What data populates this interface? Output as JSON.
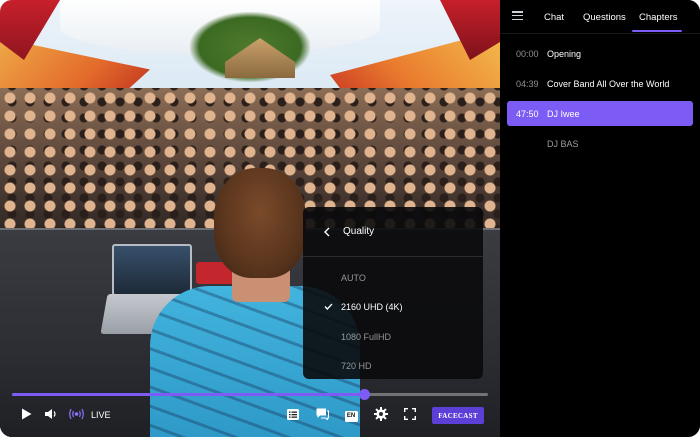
{
  "player": {
    "progress_fraction": 0.74,
    "live_label": "LIVE",
    "brand_label": "FACECAST",
    "accent_color": "#7c5cf5"
  },
  "quality_menu": {
    "title": "Quality",
    "options": [
      {
        "label": "AUTO",
        "selected": false
      },
      {
        "label": "2160 UHD (4K)",
        "selected": true
      },
      {
        "label": "1080 FullHD",
        "selected": false
      },
      {
        "label": "720 HD",
        "selected": false
      }
    ]
  },
  "panel": {
    "tabs": [
      "Chat",
      "Questions",
      "Chapters"
    ],
    "active_tab": "Chapters",
    "chapters": [
      {
        "time": "00:00",
        "title": "Opening",
        "active": false
      },
      {
        "time": "04:39",
        "title": "Cover Band All Over the World",
        "active": false
      },
      {
        "time": "47:50",
        "title": "DJ Iwee",
        "active": true
      },
      {
        "time": "",
        "title": "DJ BAS",
        "active": false
      }
    ]
  },
  "icons": {
    "play": "play-icon",
    "volume": "volume-icon",
    "live": "live-broadcast-icon",
    "chapters": "chapters-list-icon",
    "comments": "comments-icon",
    "subtitles": "language-en-icon",
    "settings": "gear-icon",
    "fullscreen": "fullscreen-icon",
    "menu": "hamburger-menu-icon"
  },
  "subtitle_badge": "EN"
}
